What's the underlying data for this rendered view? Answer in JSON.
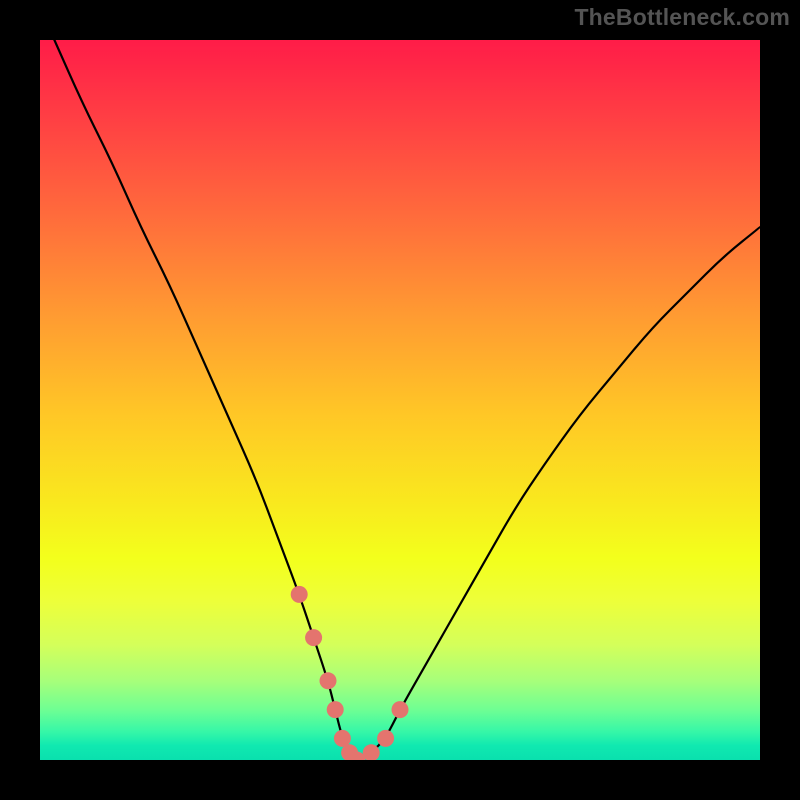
{
  "watermark": {
    "text": "TheBottleneck.com"
  },
  "chart_data": {
    "type": "line",
    "title": "",
    "xlabel": "",
    "ylabel": "",
    "xlim": [
      0,
      100
    ],
    "ylim": [
      0,
      100
    ],
    "grid": false,
    "legend": false,
    "series": [
      {
        "name": "bottleneck-curve",
        "x": [
          2,
          6,
          10,
          14,
          18,
          22,
          26,
          30,
          33,
          36,
          38,
          40,
          41,
          42,
          43,
          44,
          46,
          48,
          50,
          54,
          58,
          62,
          66,
          70,
          75,
          80,
          85,
          90,
          95,
          100
        ],
        "y": [
          100,
          91,
          83,
          74,
          66,
          57,
          48,
          39,
          31,
          23,
          17,
          11,
          7,
          3,
          1,
          0,
          1,
          3,
          7,
          14,
          21,
          28,
          35,
          41,
          48,
          54,
          60,
          65,
          70,
          74
        ],
        "color": "#000000"
      },
      {
        "name": "marker-dots",
        "x": [
          36,
          38,
          40,
          41,
          42,
          43,
          44,
          46,
          48,
          50
        ],
        "y": [
          23,
          17,
          11,
          7,
          3,
          1,
          0,
          1,
          3,
          7
        ],
        "color": "#e4746e"
      }
    ],
    "gradient_stops": [
      {
        "pos": 0,
        "color": "#ff1c48"
      },
      {
        "pos": 24,
        "color": "#ff6a3c"
      },
      {
        "pos": 52,
        "color": "#ffc726"
      },
      {
        "pos": 72,
        "color": "#f3ff1c"
      },
      {
        "pos": 93,
        "color": "#6fff93"
      },
      {
        "pos": 100,
        "color": "#0ae0ae"
      }
    ]
  }
}
